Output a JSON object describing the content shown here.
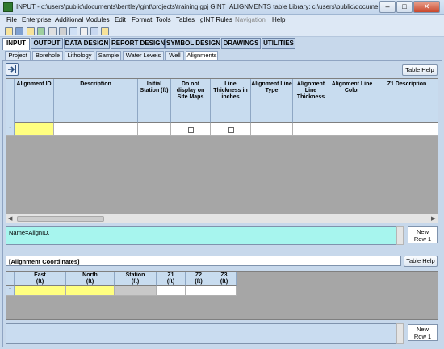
{
  "window": {
    "title": "INPUT -  c:\\users\\public\\documents\\bentley\\gint\\projects\\training.gpj  GINT_ALIGNMENTS table  Library: c:\\users\\public\\documents\\ben...",
    "minimize": "–",
    "maximize": "□",
    "close": "✕"
  },
  "menu": [
    "File",
    "Enterprise",
    "Additional Modules",
    "Edit",
    "Format",
    "Tools",
    "Tables",
    "gINT Rules",
    "Navigation",
    "Help"
  ],
  "main_tabs": [
    "INPUT",
    "OUTPUT",
    "DATA DESIGN",
    "REPORT DESIGN",
    "SYMBOL DESIGN",
    "DRAWINGS",
    "UTILITIES"
  ],
  "sub_tabs": [
    "Project",
    "Borehole",
    "Lithology",
    "Sample",
    "Water Levels",
    "Well",
    "Alignments"
  ],
  "table_help": "Table Help",
  "alignment_columns": [
    "Alignment ID",
    "Description",
    "Initial Station (ft)",
    "Do not display on Site Maps",
    "Line Thickness in inches",
    "Alignment Line Type",
    "Alignment Line Thickness",
    "Alignment Line Color",
    "Z1 Description"
  ],
  "row_marker": "*",
  "field_note": "Name=AlignID.",
  "new_row": {
    "line1": "New",
    "line2": "Row 1"
  },
  "coordinates_header": "[Alignment Coordinates]",
  "coordinate_columns": [
    {
      "name": "East",
      "unit": "(ft)"
    },
    {
      "name": "North",
      "unit": "(ft)"
    },
    {
      "name": "Station",
      "unit": "(ft)"
    },
    {
      "name": "Z1",
      "unit": "(ft)"
    },
    {
      "name": "Z2",
      "unit": "(ft)"
    },
    {
      "name": "Z3",
      "unit": "(ft)"
    }
  ],
  "colors": {
    "required_cell": "#ffff80",
    "note_bg": "#a7f5ee",
    "header_bg": "#c8dcef"
  }
}
